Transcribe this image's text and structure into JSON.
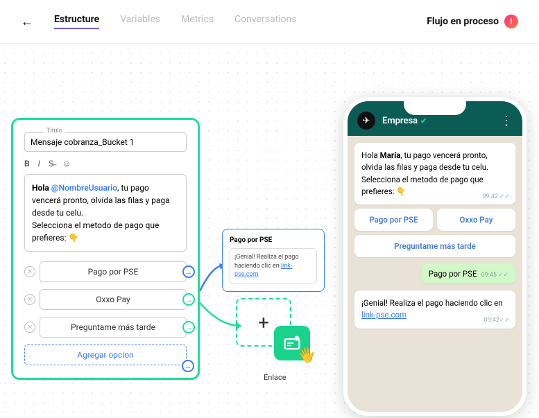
{
  "topbar": {
    "tabs": [
      "Estructure",
      "Variables",
      "Metrics",
      "Conversations"
    ],
    "status": "Flujo en proceso",
    "status_badge": "!"
  },
  "builder": {
    "title_label": "Título",
    "title_value": "Mensaje cobranza_Bucket 1",
    "fmt_bold": "B",
    "fmt_italic": "I",
    "fmt_strike": "S̶",
    "fmt_emoji": "☺",
    "msg_pre": "Hola ",
    "msg_var": "@NombreUsuario",
    "msg_post": ", tu pago vencerá pronto, olvida las filas y paga desde tu celu.",
    "msg_line2": "Selecciona el metodo de pago que prefieres: ",
    "msg_emoji": "👇",
    "options": [
      "Pago por PSE",
      "Oxxo Pay",
      "Preguntame más tarde"
    ],
    "add_option": "Agregar opcion"
  },
  "pse_card": {
    "title": "Pago por PSE",
    "body_pre": "¡Genial! Realiza el pago haciendo clic en ",
    "body_link": "link-pse.com"
  },
  "enlace": {
    "label": "Enlace",
    "plus": "+"
  },
  "phone": {
    "company": "Empresa",
    "msg1_pre": "Hola ",
    "msg1_bold": "María",
    "msg1_post": ", tu pago vencerá pronto, olvida las filas y paga desde tu celu.",
    "msg1_line2": "Selecciona el metodo de pago que prefieres: ",
    "msg1_emoji": "👇",
    "ts1": "09:42",
    "btn1": "Pago por PSE",
    "btn2": "Oxxo Pay",
    "btn3": "Preguntame más tarde",
    "reply": "Pago por PSE",
    "ts_reply": "09:45",
    "msg2_pre": "¡Genial! Realiza el pago haciendo clic en ",
    "msg2_link": "link-pse.com",
    "ts2": "09:42"
  }
}
